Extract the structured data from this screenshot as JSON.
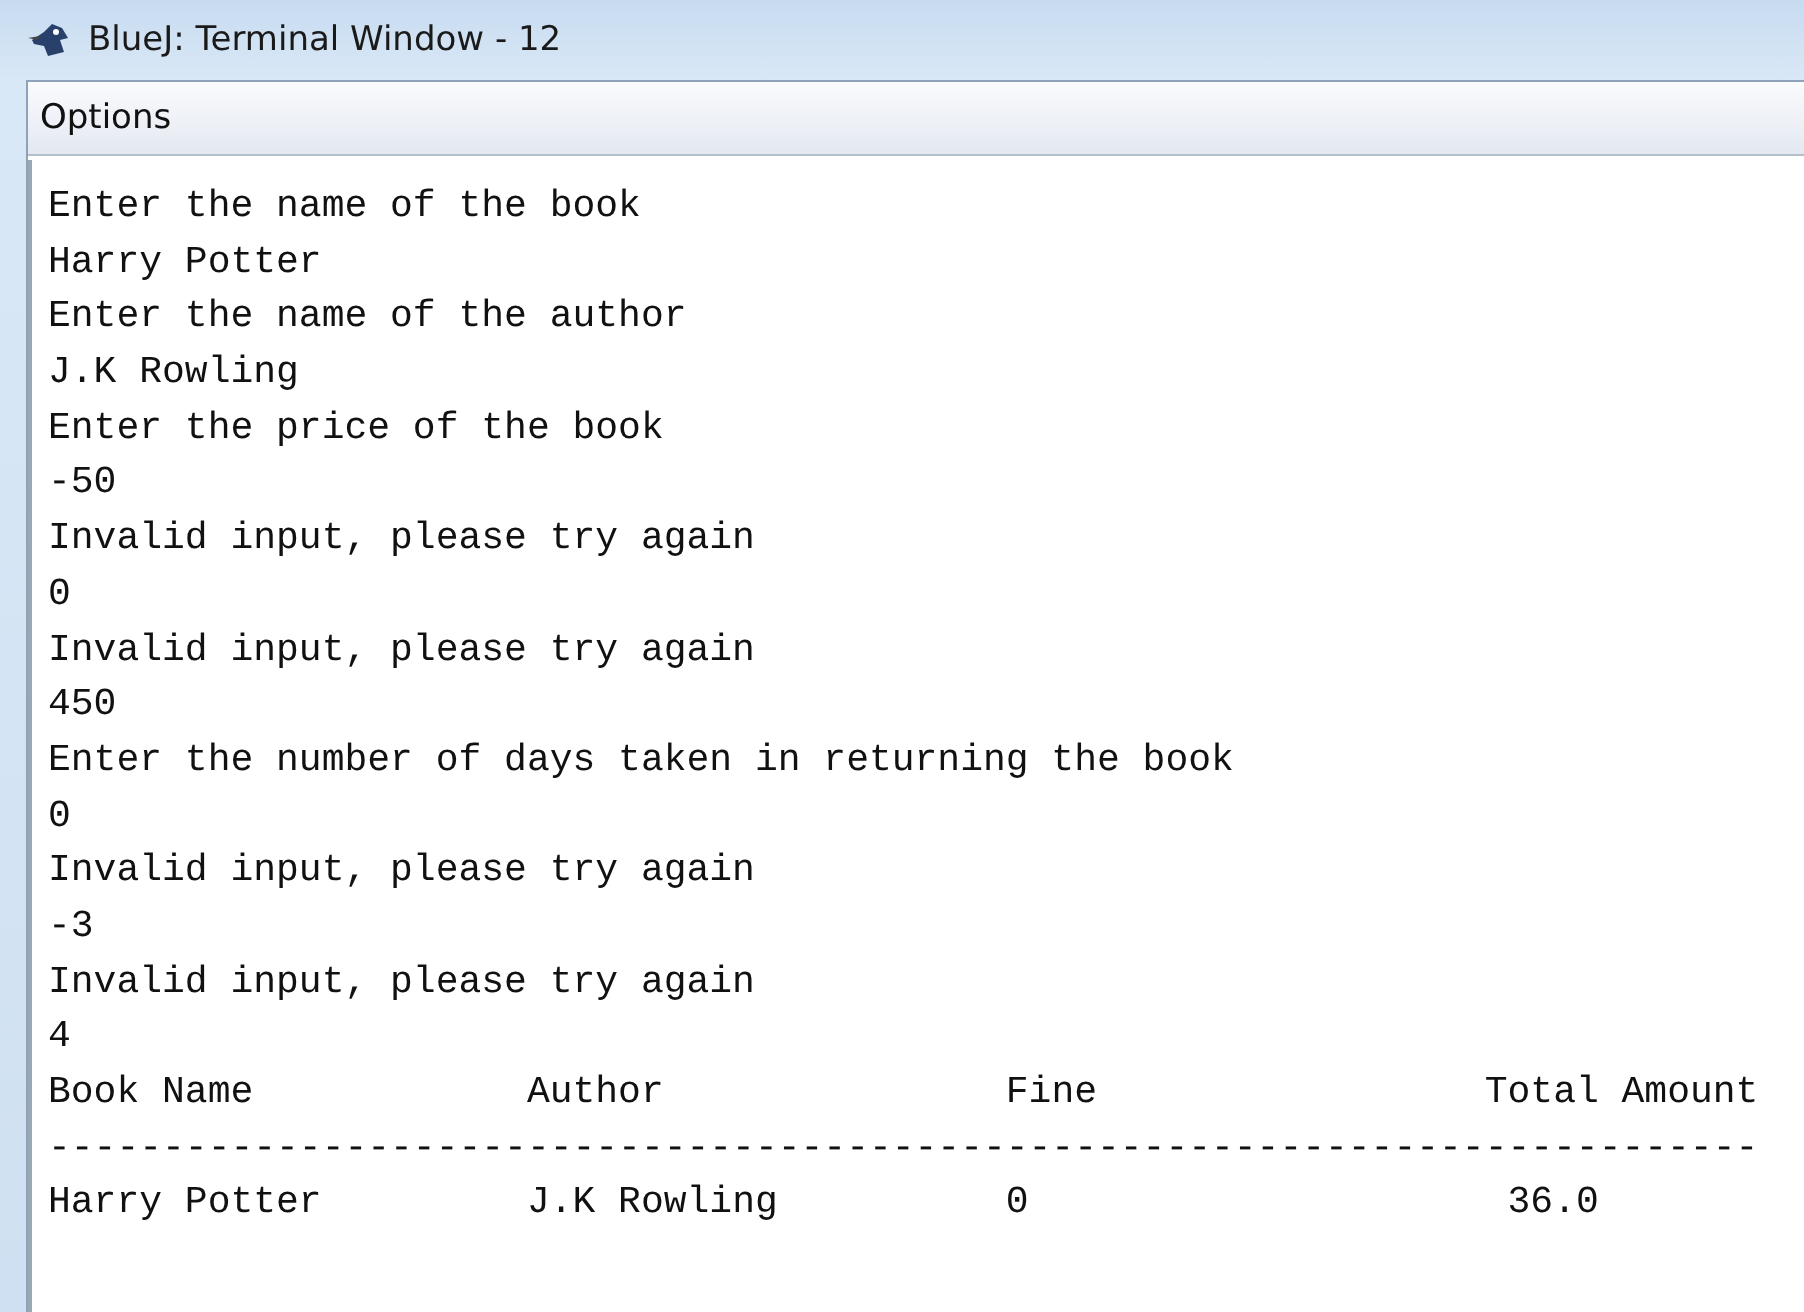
{
  "window": {
    "title": "BlueJ: Terminal Window - 12"
  },
  "menu": [
    "Options"
  ],
  "terminal": {
    "lines": [
      "Enter the name of the book",
      "Harry Potter",
      "Enter the name of the author",
      "J.K Rowling",
      "Enter the price of the book",
      "-50",
      "Invalid input, please try again",
      "0",
      "Invalid input, please try again",
      "450",
      "Enter the number of days taken in returning the book",
      "0",
      "Invalid input, please try again",
      "-3",
      "Invalid input, please try again",
      "4",
      "Book Name            Author               Fine                 Total Amount",
      "---------------------------------------------------------------------------",
      "Harry Potter         J.K Rowling          0                     36.0"
    ]
  }
}
